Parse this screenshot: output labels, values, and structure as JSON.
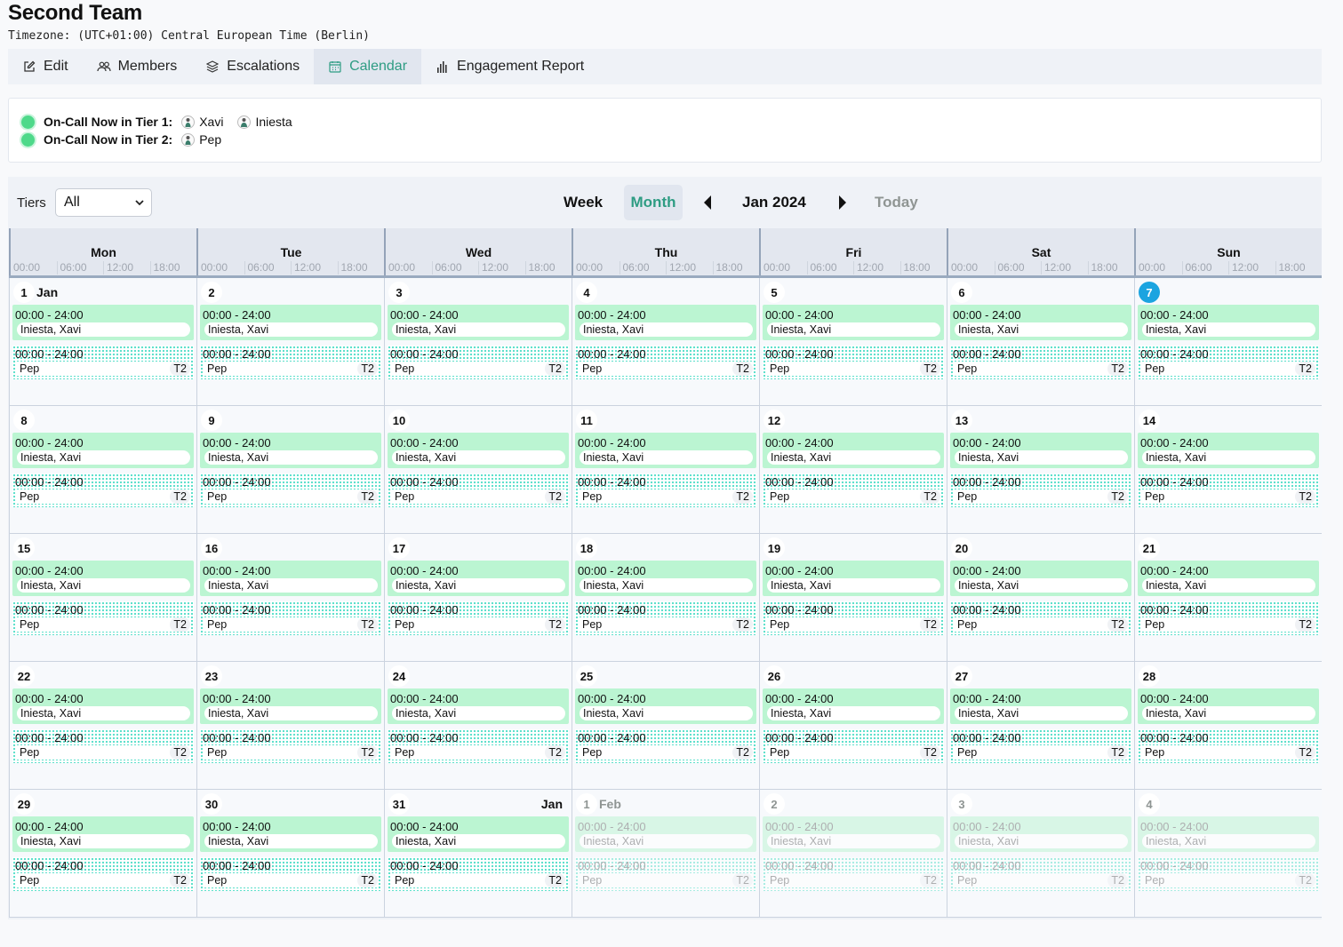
{
  "header": {
    "title": "Second Team",
    "timezone": "Timezone: (UTC+01:00) Central European Time (Berlin)"
  },
  "tabs": [
    {
      "label": "Edit",
      "icon": "edit-icon",
      "active": false
    },
    {
      "label": "Members",
      "icon": "members-icon",
      "active": false
    },
    {
      "label": "Escalations",
      "icon": "layers-icon",
      "active": false
    },
    {
      "label": "Calendar",
      "icon": "calendar-icon",
      "active": true
    },
    {
      "label": "Engagement Report",
      "icon": "bar-chart-icon",
      "active": false
    }
  ],
  "oncall": {
    "tier1": {
      "label": "On-Call Now in Tier 1:",
      "people": [
        "Xavi",
        "Iniesta"
      ]
    },
    "tier2": {
      "label": "On-Call Now in Tier 2:",
      "people": [
        "Pep"
      ]
    }
  },
  "toolbar": {
    "tiers_label": "Tiers",
    "tiers_value": "All",
    "week_label": "Week",
    "month_label": "Month",
    "period": "Jan 2024",
    "today_label": "Today",
    "active_view": "Month"
  },
  "weekdays": [
    "Mon",
    "Tue",
    "Wed",
    "Thu",
    "Fri",
    "Sat",
    "Sun"
  ],
  "hour_ticks": [
    "00:00",
    "06:00",
    "12:00",
    "18:00"
  ],
  "colors": {
    "accent": "#2e9c83",
    "tier1_event": "#bbf5d2",
    "tier2_dots": "#5fe0cc",
    "today_badge": "#1ba4e0",
    "oncall_dot": "#4ed98a"
  },
  "event_template": {
    "tier1": {
      "time": "00:00 - 24:00",
      "people": "Iniesta, Xavi"
    },
    "tier2": {
      "time": "00:00 - 24:00",
      "people": "Pep",
      "tier": "T2"
    }
  },
  "weeks": [
    [
      {
        "day": "1",
        "month": "Jan"
      },
      {
        "day": "2"
      },
      {
        "day": "3"
      },
      {
        "day": "4"
      },
      {
        "day": "5"
      },
      {
        "day": "6"
      },
      {
        "day": "7",
        "today": true
      }
    ],
    [
      {
        "day": "8"
      },
      {
        "day": "9"
      },
      {
        "day": "10"
      },
      {
        "day": "11"
      },
      {
        "day": "12"
      },
      {
        "day": "13"
      },
      {
        "day": "14"
      }
    ],
    [
      {
        "day": "15"
      },
      {
        "day": "16"
      },
      {
        "day": "17"
      },
      {
        "day": "18"
      },
      {
        "day": "19"
      },
      {
        "day": "20"
      },
      {
        "day": "21"
      }
    ],
    [
      {
        "day": "22"
      },
      {
        "day": "23"
      },
      {
        "day": "24"
      },
      {
        "day": "25"
      },
      {
        "day": "26"
      },
      {
        "day": "27"
      },
      {
        "day": "28"
      }
    ],
    [
      {
        "day": "29"
      },
      {
        "day": "30"
      },
      {
        "day": "31",
        "month_right": "Jan"
      },
      {
        "day": "1",
        "month": "Feb",
        "other": true
      },
      {
        "day": "2",
        "other": true
      },
      {
        "day": "3",
        "other": true
      },
      {
        "day": "4",
        "other": true
      }
    ]
  ]
}
